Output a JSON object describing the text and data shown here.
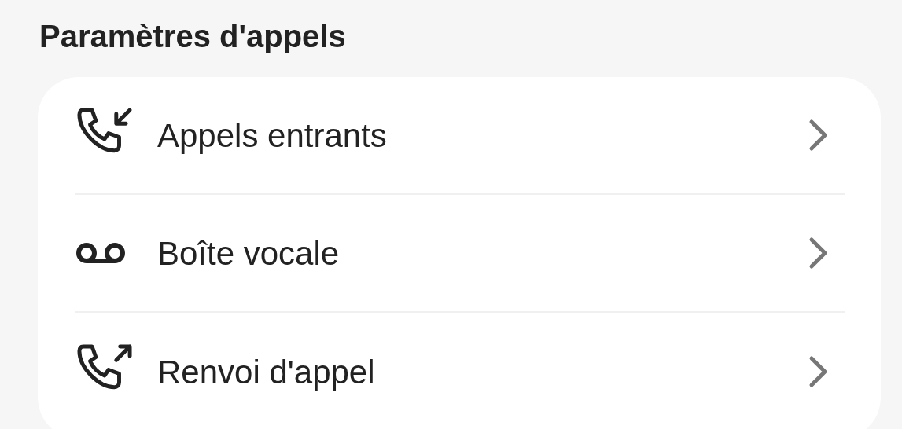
{
  "section_title": "Paramètres d'appels",
  "items": [
    {
      "kind": "incoming",
      "label": "Appels entrants"
    },
    {
      "kind": "voicemail",
      "label": "Boîte vocale"
    },
    {
      "kind": "forward",
      "label": "Renvoi d'appel"
    }
  ]
}
